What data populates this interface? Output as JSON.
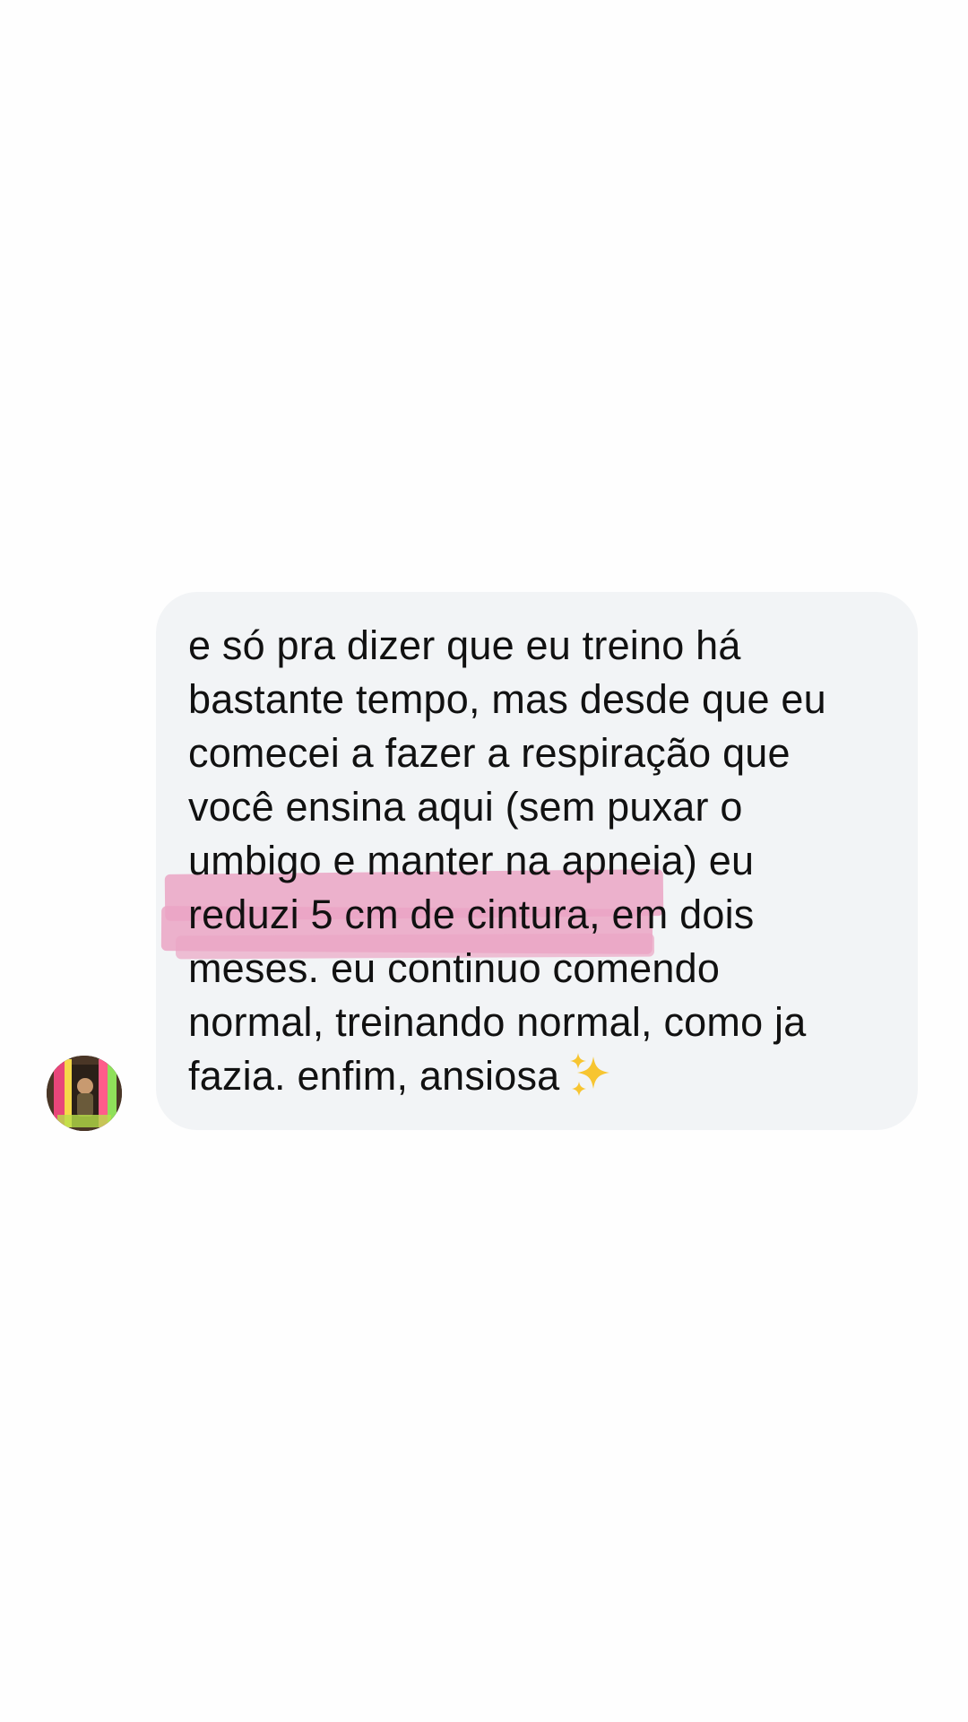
{
  "conversation": {
    "avatar_icon": "user-avatar-photo",
    "message": {
      "lines": [
        "e só pra dizer que eu treino há",
        "bastante tempo, mas desde que eu",
        "comecei a fazer a respiração que",
        "você ensina aqui (sem puxar o",
        "umbigo e manter na apneia) eu",
        "reduzi 5 cm de cintura, em dois",
        "meses. eu continuo comendo",
        "normal, treinando normal, como ja",
        "fazia. enfim, ansiosa"
      ],
      "emoji_icon": "sparkles-icon",
      "highlighted_phrase": "reduzi 5 cm de cintura,",
      "highlight_color": "#eba5c4",
      "bubble_color": "#f2f4f6",
      "text_color": "#111111"
    }
  }
}
